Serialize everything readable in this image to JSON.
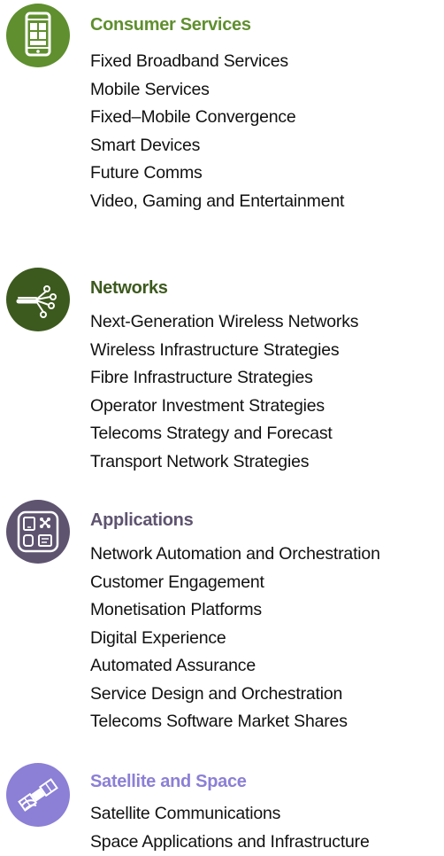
{
  "sections": [
    {
      "title": "Consumer Services",
      "color": "#5f8f2e",
      "icon": "mobile-device-icon",
      "items": [
        "Fixed Broadband Services",
        "Mobile Services",
        "Fixed–Mobile Convergence",
        "Smart Devices",
        "Future Comms",
        "Video, Gaming and Entertainment"
      ]
    },
    {
      "title": "Networks",
      "color": "#3d5a1e",
      "icon": "network-cable-icon",
      "items": [
        "Next-Generation Wireless Networks",
        "Wireless Infrastructure Strategies",
        "Fibre Infrastructure Strategies",
        "Operator Investment Strategies",
        "Telecoms Strategy and Forecast",
        "Transport Network Strategies"
      ]
    },
    {
      "title": "Applications",
      "color": "#5e5470",
      "icon": "apps-icon",
      "items": [
        "Network Automation and Orchestration",
        "Customer Engagement",
        "Monetisation Platforms",
        "Digital Experience",
        "Automated Assurance",
        "Service Design and Orchestration",
        "Telecoms Software Market Shares"
      ]
    },
    {
      "title": "Satellite and Space",
      "color": "#8b7fd6",
      "icon": "satellite-icon",
      "items": [
        "Satellite Communications",
        "Space Applications and Infrastructure"
      ]
    }
  ]
}
